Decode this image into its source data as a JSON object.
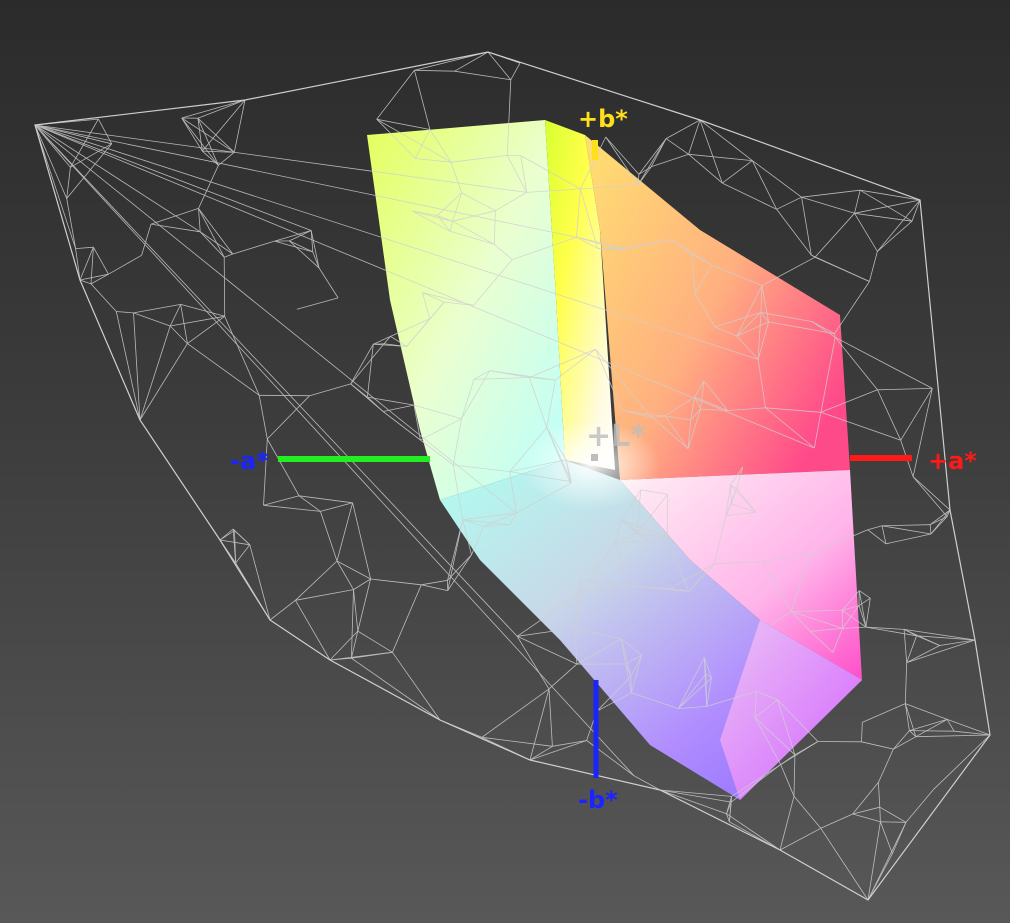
{
  "diagram": {
    "labels": {
      "plus_b": "+b*",
      "minus_b": "-b*",
      "plus_a": "+a*",
      "minus_a": "-a*",
      "plus_l": "+L*"
    },
    "colors": {
      "background": "#3a3a3a",
      "wireframe": "#d0d0d0",
      "plus_b": "#ffe01a",
      "minus_b": "#1a24ff",
      "plus_a": "#ff1a1a",
      "minus_a": "#1a24ff",
      "minus_a_line": "#22ee22",
      "plus_l": "#bdbdbd"
    }
  }
}
